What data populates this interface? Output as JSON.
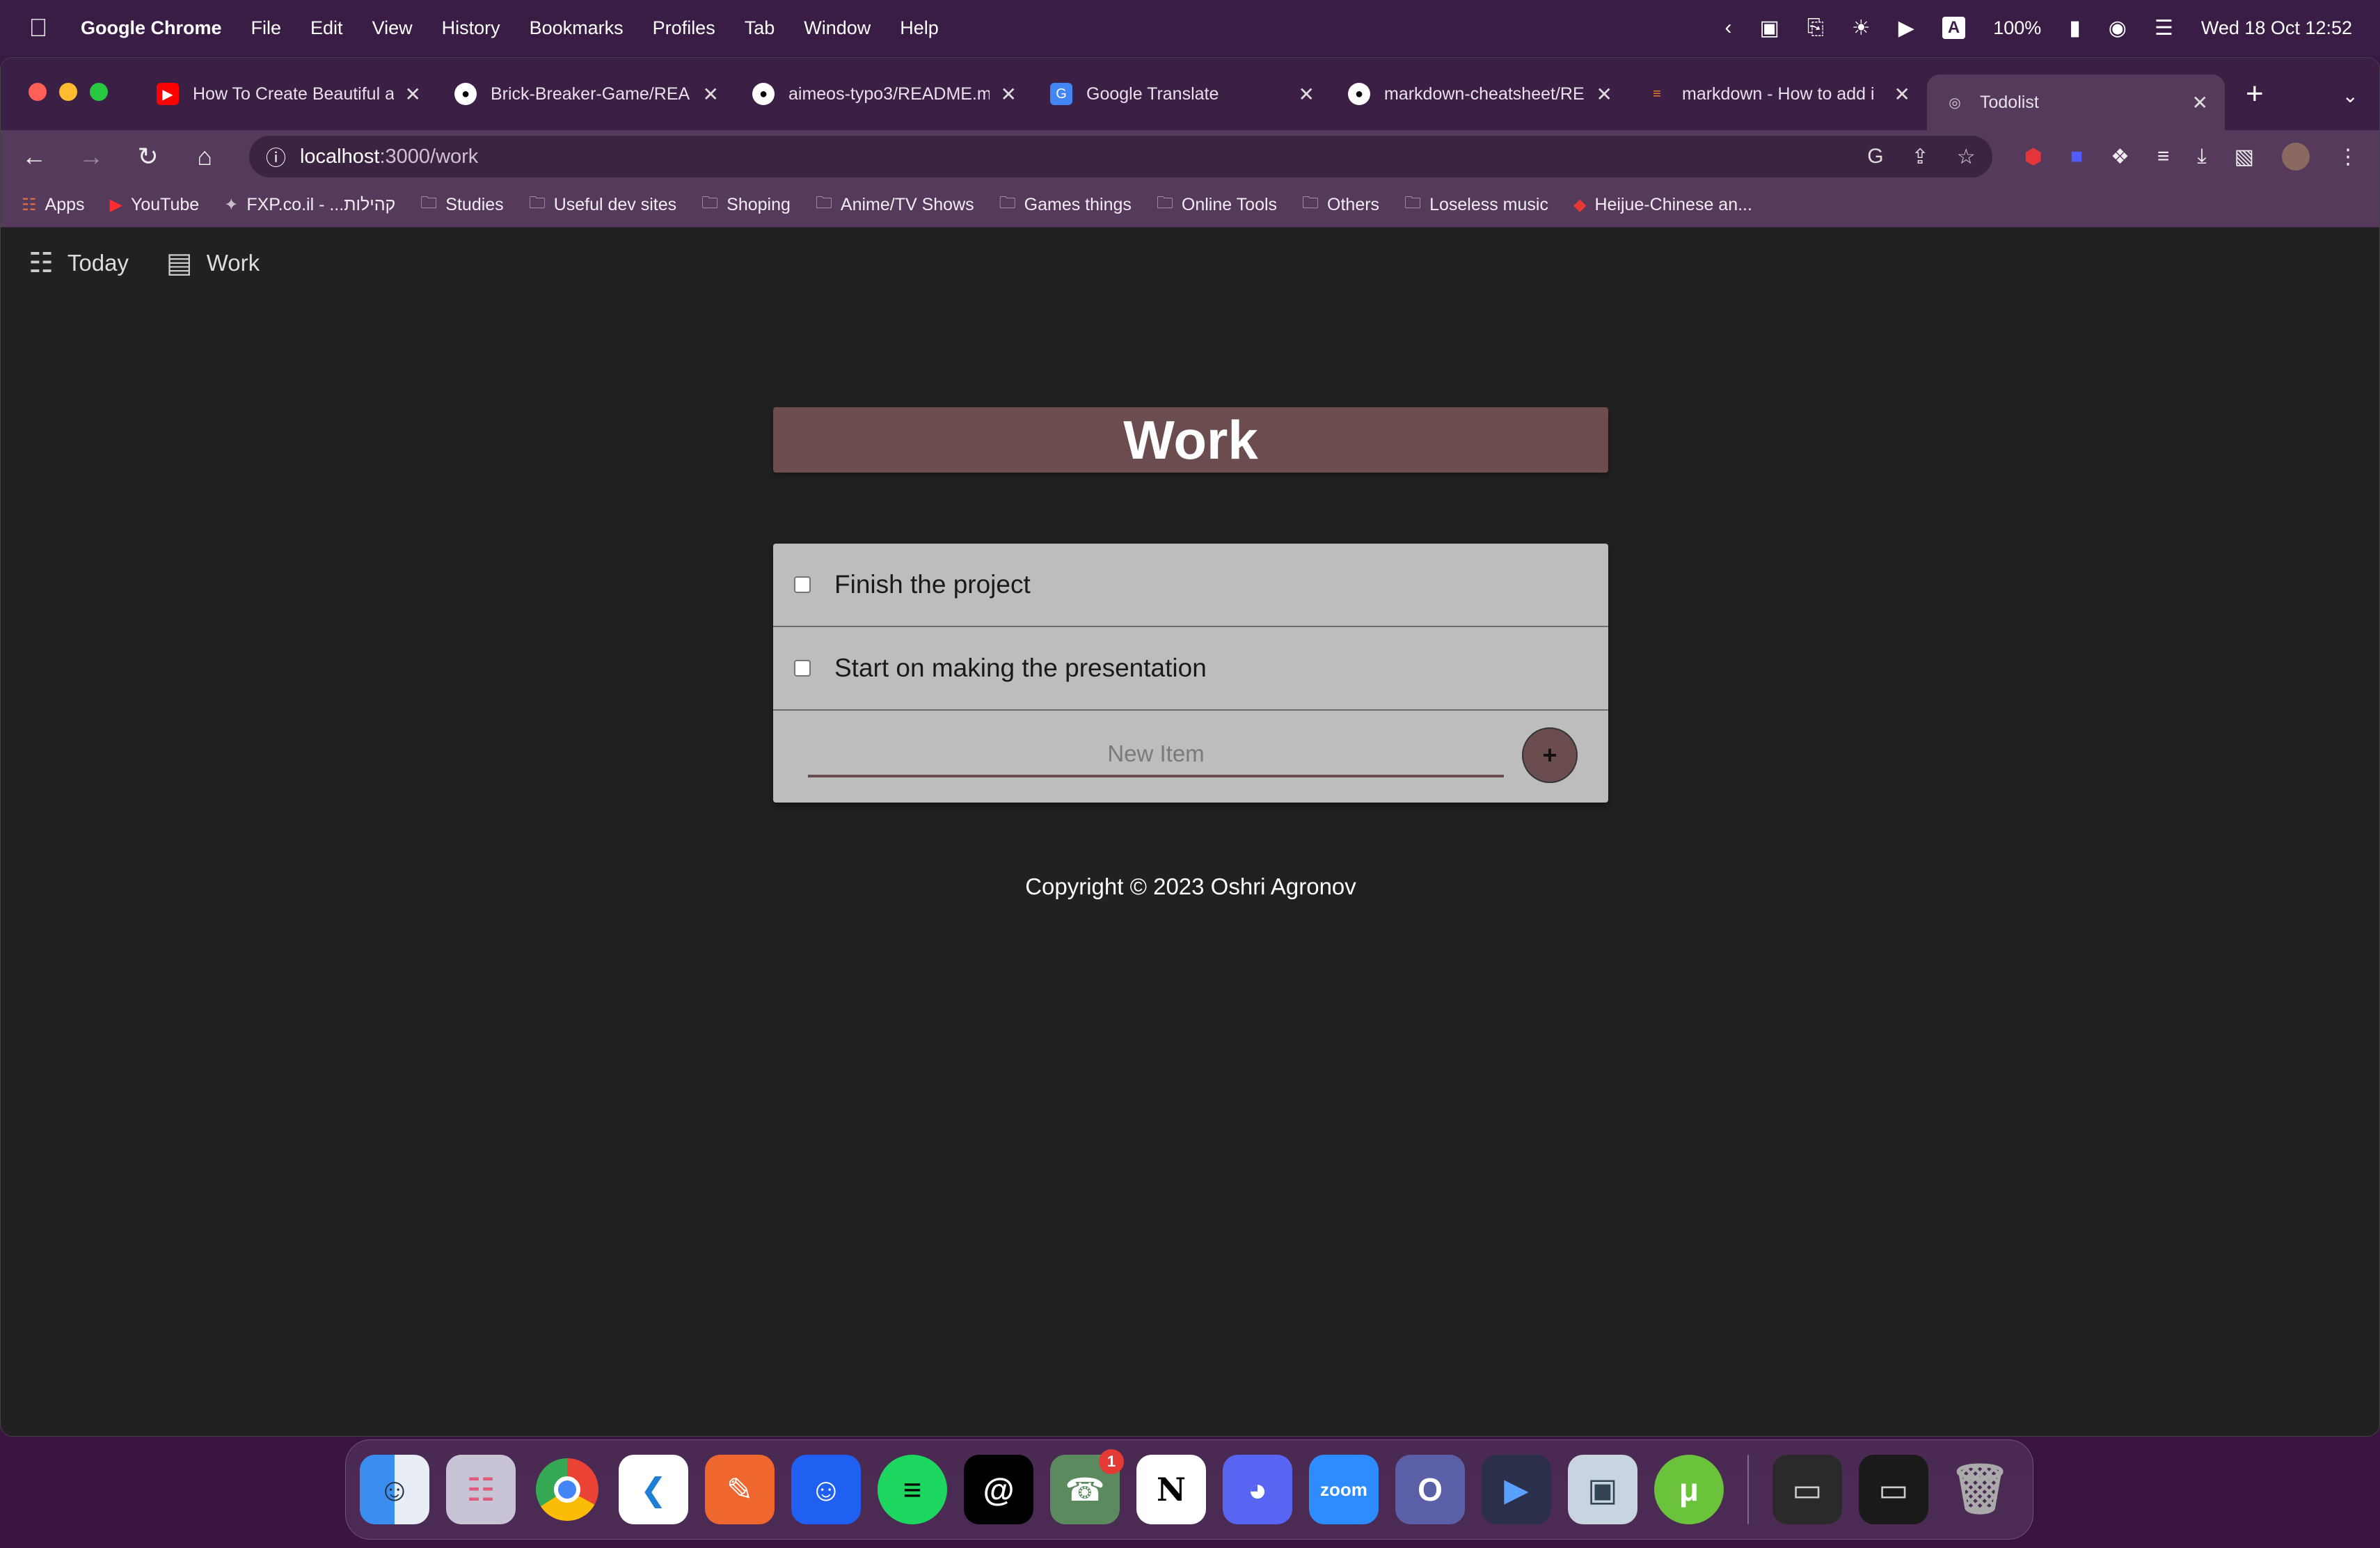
{
  "menubar": {
    "app_name": "Google Chrome",
    "items": [
      "File",
      "Edit",
      "View",
      "History",
      "Bookmarks",
      "Profiles",
      "Tab",
      "Window",
      "Help"
    ],
    "battery": "100%",
    "input_source": "A",
    "datetime": "Wed 18 Oct  12:52"
  },
  "tabs": [
    {
      "title": "How To Create Beautiful a",
      "favicon": "youtube-icon",
      "color": "#ff0000"
    },
    {
      "title": "Brick-Breaker-Game/REA",
      "favicon": "github-icon",
      "color": "#ffffff"
    },
    {
      "title": "aimeos-typo3/README.m",
      "favicon": "github-icon",
      "color": "#ffffff"
    },
    {
      "title": "Google Translate",
      "favicon": "translate-icon",
      "color": "#4285f4"
    },
    {
      "title": "markdown-cheatsheet/RE",
      "favicon": "github-icon",
      "color": "#ffffff"
    },
    {
      "title": "markdown - How to add i",
      "favicon": "stackoverflow-icon",
      "color": "#f48024"
    },
    {
      "title": "Todolist",
      "favicon": "globe-icon",
      "color": "#cccccc",
      "active": true
    }
  ],
  "address": {
    "host": "localhost",
    "path": ":3000/work"
  },
  "bookmarks": [
    {
      "label": "Apps",
      "icon": "apps-grid-icon"
    },
    {
      "label": "YouTube",
      "icon": "youtube-icon"
    },
    {
      "label": "FXP.co.il - ...קהילות",
      "icon": "fxp-icon"
    },
    {
      "label": "Studies",
      "icon": "folder-icon"
    },
    {
      "label": "Useful dev sites",
      "icon": "folder-icon"
    },
    {
      "label": "Shoping",
      "icon": "folder-icon"
    },
    {
      "label": "Anime/TV Shows",
      "icon": "folder-icon"
    },
    {
      "label": "Games things",
      "icon": "folder-icon"
    },
    {
      "label": "Online Tools",
      "icon": "folder-icon"
    },
    {
      "label": "Others",
      "icon": "folder-icon"
    },
    {
      "label": "Loseless music",
      "icon": "folder-icon"
    },
    {
      "label": "Heijue-Chinese an...",
      "icon": "heijue-icon"
    }
  ],
  "page": {
    "nav": [
      {
        "label": "Today",
        "icon": "calendar-list-icon"
      },
      {
        "label": "Work",
        "icon": "briefcase-icon"
      }
    ],
    "heading": "Work",
    "items": [
      {
        "text": "Finish the project",
        "checked": false
      },
      {
        "text": "Start on making the presentation",
        "checked": false
      }
    ],
    "new_item_placeholder": "New Item",
    "add_button_label": "+",
    "footer": "Copyright © 2023 Oshri Agronov"
  },
  "dock": {
    "apps": [
      "finder",
      "launchpad",
      "chrome",
      "vscode",
      "pen",
      "xcode-face",
      "spotify",
      "threads",
      "whatsapp",
      "notion",
      "discord",
      "zoom",
      "outlook",
      "player",
      "preview",
      "utorrent"
    ],
    "whatsapp_badge": "1"
  },
  "colors": {
    "accent": "#6b4d4f",
    "page_bg": "#212121",
    "list_bg": "#bdbdbd"
  }
}
